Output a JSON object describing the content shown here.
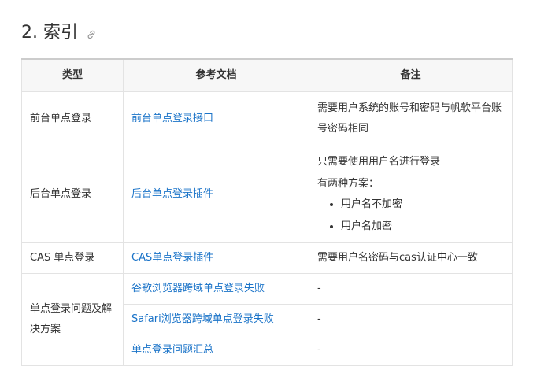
{
  "heading": {
    "title": "2. 索引",
    "anchor_icon": "link-icon",
    "icon_color": "#999999"
  },
  "colors": {
    "link": "#1a73c8",
    "border": "#e3e3e3",
    "header_bg": "#f7f7f7"
  },
  "table": {
    "headers": [
      "类型",
      "参考文档",
      "备注"
    ],
    "rows": [
      {
        "type": "前台单点登录",
        "docs": [
          "前台单点登录接口"
        ],
        "note_lines": [
          "需要用户系统的账号和密码与帆软平台账号密码相同"
        ]
      },
      {
        "type": "后台单点登录",
        "docs": [
          "后台单点登录插件"
        ],
        "note_lines": [
          "只需要使用用户名进行登录",
          "有两种方案："
        ],
        "note_bullets": [
          "用户名不加密",
          "用户名加密"
        ]
      },
      {
        "type": "CAS 单点登录",
        "docs": [
          "CAS单点登录插件"
        ],
        "note_lines": [
          "需要用户名密码与cas认证中心一致"
        ]
      },
      {
        "type": "单点登录问题及解决方案",
        "docs": [
          "谷歌浏览器跨域单点登录失败",
          "Safari浏览器跨域单点登录失败",
          "单点登录问题汇总"
        ],
        "notes": [
          "-",
          "-",
          "-"
        ]
      }
    ]
  }
}
